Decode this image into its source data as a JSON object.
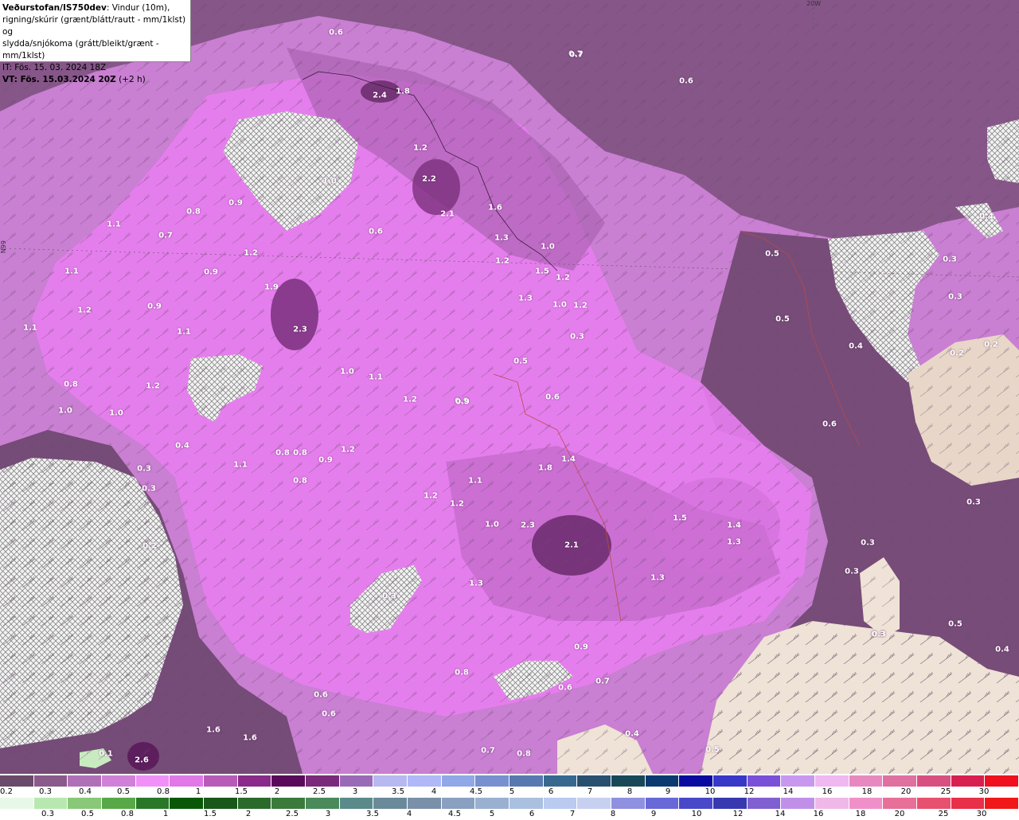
{
  "header": {
    "line1_bold": "Veðurstofan/IS750dev",
    "line1_rest": ": Vindur (10m),",
    "line2": "rigning/skúrir (grænt/blátt/rautt - mm/1klst) og",
    "line3": "slydda/snjókoma (grátt/bleikt/grænt - mm/1klst)",
    "line4": "IT: Fös. 15. 03. 2024 18Z",
    "line5_bold": "VT: Fös. 15.03.2024 20Z",
    "line5_rest": " (+2 h)"
  },
  "grid_labels": {
    "lon": "20W",
    "lat": "N99"
  },
  "map_values": [
    {
      "text": "0.6"
    },
    {
      "text": "0.7"
    },
    {
      "text": "0.6"
    },
    {
      "text": "2.4"
    },
    {
      "text": "1.8"
    },
    {
      "text": "1.2"
    },
    {
      "text": "2.2"
    },
    {
      "text": "2.1"
    },
    {
      "text": "1.6"
    },
    {
      "text": "1.0"
    },
    {
      "text": "0.9"
    },
    {
      "text": "0.8"
    },
    {
      "text": "1.1"
    },
    {
      "text": "0.7"
    },
    {
      "text": "0.6"
    },
    {
      "text": "1.2"
    },
    {
      "text": "1.1"
    },
    {
      "text": "0.9"
    },
    {
      "text": "1.9"
    },
    {
      "text": "1.3"
    },
    {
      "text": "1.2"
    },
    {
      "text": "1.0"
    },
    {
      "text": "1.5"
    },
    {
      "text": "1.2"
    },
    {
      "text": "1.2"
    },
    {
      "text": "0.9"
    },
    {
      "text": "1.3"
    },
    {
      "text": "1.0"
    },
    {
      "text": "1.2"
    },
    {
      "text": "2.3"
    },
    {
      "text": "1.1"
    },
    {
      "text": "1.1"
    },
    {
      "text": "0.3"
    },
    {
      "text": "1.0"
    },
    {
      "text": "0.8"
    },
    {
      "text": "1.2"
    },
    {
      "text": "1.0"
    },
    {
      "text": "1.1"
    },
    {
      "text": "0.5"
    },
    {
      "text": "0.9"
    },
    {
      "text": "1.0"
    },
    {
      "text": "1.2"
    },
    {
      "text": "0.9"
    },
    {
      "text": "0.6"
    },
    {
      "text": "0.4"
    },
    {
      "text": "0.3"
    },
    {
      "text": "0.8"
    },
    {
      "text": "0.9"
    },
    {
      "text": "1.2"
    },
    {
      "text": "1.1"
    },
    {
      "text": "0.3"
    },
    {
      "text": "0.8"
    },
    {
      "text": "1.8"
    },
    {
      "text": "1.4"
    },
    {
      "text": "1.1"
    },
    {
      "text": "1.2"
    },
    {
      "text": "1.2"
    },
    {
      "text": "1.0"
    },
    {
      "text": "2.3"
    },
    {
      "text": "2.1"
    },
    {
      "text": "0.2"
    },
    {
      "text": "1.5"
    },
    {
      "text": "1.4"
    },
    {
      "text": "1.3"
    },
    {
      "text": "1.3"
    },
    {
      "text": "1.3"
    },
    {
      "text": "0.3"
    },
    {
      "text": "0.5"
    },
    {
      "text": "0.5"
    },
    {
      "text": "0.4"
    },
    {
      "text": "0.6"
    },
    {
      "text": "0.4"
    },
    {
      "text": "0.3"
    },
    {
      "text": "0.3"
    },
    {
      "text": "0.2"
    },
    {
      "text": "0.2"
    },
    {
      "text": "0.3"
    },
    {
      "text": "0.3"
    },
    {
      "text": "0.3"
    },
    {
      "text": "0.3"
    },
    {
      "text": "0.3"
    },
    {
      "text": "0.9"
    },
    {
      "text": "0.7"
    },
    {
      "text": "0.8"
    },
    {
      "text": "0.8"
    },
    {
      "text": "0.7"
    },
    {
      "text": "0.5"
    },
    {
      "text": "0.4"
    },
    {
      "text": "0.6"
    },
    {
      "text": "0.6"
    },
    {
      "text": "0.6"
    },
    {
      "text": "1.6"
    },
    {
      "text": "1.6"
    },
    {
      "text": "2.6"
    },
    {
      "text": "0.7"
    },
    {
      "text": "0.8"
    },
    {
      "text": "0.4"
    },
    {
      "text": "0.5"
    },
    {
      "text": "0.1"
    }
  ],
  "legend": {
    "top_colors": [
      "#6a4a6a",
      "#8a5a8a",
      "#b070b8",
      "#d080d8",
      "#f090f8",
      "#e078e8",
      "#b85ab8",
      "#8a2a8a",
      "#5a0a5a",
      "#7a2a7a",
      "#9a6ab8",
      "#b8b8f0",
      "#b0b8f8",
      "#90a8e8",
      "#7890d0",
      "#5878b0",
      "#386890",
      "#2a5070",
      "#184858",
      "#0a3a70",
      "#0a0aa0",
      "#3838c8",
      "#7a50d8",
      "#c898f0",
      "#f0b8f0",
      "#e888c0",
      "#e070a0",
      "#d85080",
      "#d82050",
      "#f01020"
    ],
    "top_labels": [
      "0.2",
      "0.3",
      "0.4",
      "0.5",
      "0.8",
      "1",
      "1.5",
      "2",
      "2.5",
      "3",
      "3.5",
      "4",
      "4.5",
      "5",
      "6",
      "7",
      "8",
      "9",
      "10",
      "12",
      "14",
      "16",
      "18",
      "20",
      "25",
      "30"
    ],
    "bottom_colors": [
      "#e8f8e8",
      "#b8e8b0",
      "#88c878",
      "#58a848",
      "#287828",
      "#085808",
      "#185818",
      "#2a6a2a",
      "#3a7a3a",
      "#4a8a5a",
      "#5a8a8a",
      "#6a8a9a",
      "#7a90a8",
      "#8aa0c0",
      "#9ab0d0",
      "#aac0e0",
      "#bacaf0",
      "#c8d0f0",
      "#9090e0",
      "#6868d8",
      "#4848c8",
      "#3838b0",
      "#8060d0",
      "#c090e8",
      "#f0b8e8",
      "#f090c8",
      "#e87098",
      "#e85070",
      "#e83048",
      "#f01818"
    ],
    "bottom_labels": [
      "0.3",
      "0.5",
      "0.8",
      "1",
      "1.5",
      "2",
      "2.5",
      "3",
      "3.5",
      "4",
      "4.5",
      "5",
      "6",
      "7",
      "8",
      "9",
      "10",
      "12",
      "14",
      "16",
      "18",
      "20",
      "25",
      "30"
    ]
  }
}
